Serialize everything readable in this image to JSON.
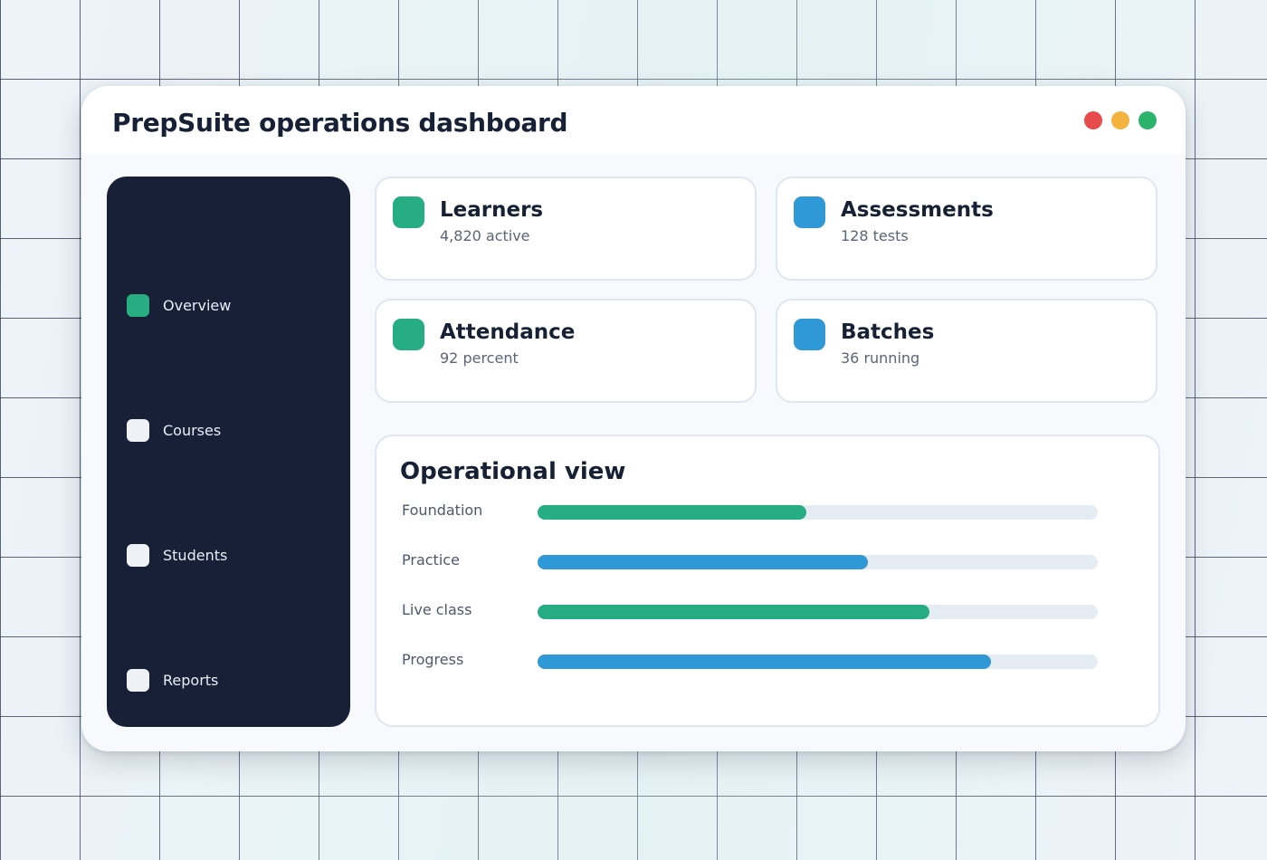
{
  "app": {
    "title": "PrepSuite operations dashboard",
    "window_controls": [
      {
        "name": "close",
        "color": "#e84b4b"
      },
      {
        "name": "minimize",
        "color": "#f3b33e"
      },
      {
        "name": "maximize",
        "color": "#2cb36b"
      }
    ]
  },
  "sidebar": {
    "items": [
      {
        "label": "Overview",
        "active": true,
        "icon": "square-icon",
        "color": "#26ad82"
      },
      {
        "label": "Courses",
        "active": false,
        "icon": "square-icon",
        "color": "#eef2f7"
      },
      {
        "label": "Students",
        "active": false,
        "icon": "square-icon",
        "color": "#eef2f7"
      },
      {
        "label": "Reports",
        "active": false,
        "icon": "square-icon",
        "color": "#eef2f7"
      }
    ]
  },
  "cards": [
    {
      "title": "Learners",
      "subtitle": "4,820 active",
      "icon": "learners-icon",
      "color": "#26ad82"
    },
    {
      "title": "Assessments",
      "subtitle": "128 tests",
      "icon": "assessments-icon",
      "color": "#2f98d6"
    },
    {
      "title": "Attendance",
      "subtitle": "92 percent",
      "icon": "attendance-icon",
      "color": "#26ad82"
    },
    {
      "title": "Batches",
      "subtitle": "36 running",
      "icon": "batches-icon",
      "color": "#2f98d6"
    }
  ],
  "operational_view": {
    "title": "Operational view",
    "rows": [
      {
        "label": "Foundation",
        "progress": 0.48,
        "color": "#26ad82"
      },
      {
        "label": "Practice",
        "progress": 0.59,
        "color": "#2f98d6"
      },
      {
        "label": "Live class",
        "progress": 0.7,
        "color": "#26ad82"
      },
      {
        "label": "Progress",
        "progress": 0.81,
        "color": "#2f98d6"
      }
    ]
  },
  "colors": {
    "sidebar_bg": "#172037",
    "track": "#e6ecf4",
    "text_dark": "#172136"
  }
}
